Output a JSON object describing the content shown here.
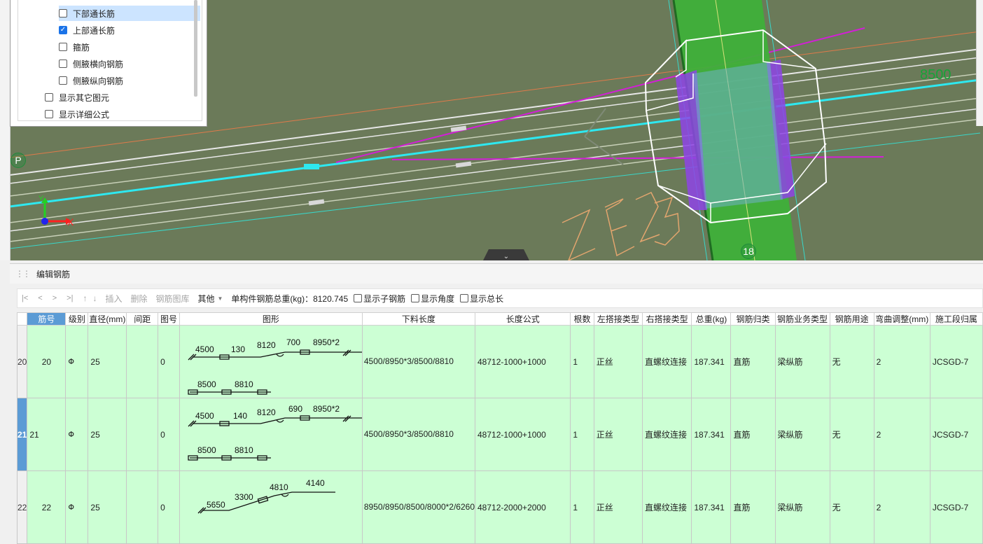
{
  "layer_panel": {
    "items": [
      {
        "label": "下部通长筋",
        "checked": false,
        "selected": true
      },
      {
        "label": "上部通长筋",
        "checked": true,
        "selected": false
      },
      {
        "label": "箍筋",
        "checked": false,
        "selected": false
      },
      {
        "label": "侧腋横向钢筋",
        "checked": false,
        "selected": false
      },
      {
        "label": "侧腋纵向钢筋",
        "checked": false,
        "selected": false
      },
      {
        "label": "显示其它图元",
        "checked": false,
        "selected": false
      },
      {
        "label": "显示详细公式",
        "checked": false,
        "selected": false
      }
    ]
  },
  "viewport": {
    "dim_label": "8500",
    "component_label": "ZE25",
    "axis_marker_p": "P",
    "axis_marker_18": "18",
    "axis_x": "X",
    "axis_y": "Y"
  },
  "editor": {
    "title": "编辑钢筋",
    "toolbar": {
      "nav": [
        "|<",
        "<",
        ">",
        ">|"
      ],
      "insert": "插入",
      "delete": "删除",
      "library": "钢筋图库",
      "other": "其他",
      "total_label": "单构件钢筋总重(kg)：8120.745",
      "checks": [
        "显示子钢筋",
        "显示角度",
        "显示总长"
      ]
    },
    "columns": [
      "筋号",
      "级别",
      "直径(mm)",
      "间距",
      "图号",
      "图形",
      "下料长度",
      "长度公式",
      "根数",
      "左搭接类型",
      "右搭接类型",
      "总重(kg)",
      "钢筋归类",
      "钢筋业务类型",
      "钢筋用途",
      "弯曲调整(mm)",
      "施工段归属"
    ],
    "rows": [
      {
        "row": "20",
        "jin": "20",
        "level": "Φ",
        "dia": "25",
        "spacing": "",
        "fig": "0",
        "shape": {
          "a": "4500",
          "b": "130",
          "c": "8120",
          "d": "700",
          "e": "8950*2",
          "f": "8500",
          "g": "8810"
        },
        "cut": "4500/8950*3/8500/8810",
        "formula": "48712-1000+1000",
        "count": "1",
        "left": "正丝",
        "right": "直螺纹连接",
        "weight": "187.341",
        "cat": "直筋",
        "biz": "梁纵筋",
        "use": "无",
        "bend": "2",
        "seg": "JCSGD-7"
      },
      {
        "row": "21",
        "jin": "21",
        "level": "Φ",
        "dia": "25",
        "spacing": "",
        "fig": "0",
        "shape": {
          "a": "4500",
          "b": "140",
          "c": "8120",
          "d": "690",
          "e": "8950*2",
          "f": "8500",
          "g": "8810"
        },
        "cut": "4500/8950*3/8500/8810",
        "formula": "48712-1000+1000",
        "count": "1",
        "left": "正丝",
        "right": "直螺纹连接",
        "weight": "187.341",
        "cat": "直筋",
        "biz": "梁纵筋",
        "use": "无",
        "bend": "2",
        "seg": "JCSGD-7"
      },
      {
        "row": "22",
        "jin": "22",
        "level": "Φ",
        "dia": "25",
        "spacing": "",
        "fig": "0",
        "shape": {
          "a": "5650",
          "b": "3300",
          "c": "4810",
          "d": "4140"
        },
        "cut": "8950/8950/8500/8000*2/6260",
        "formula": "48712-2000+2000",
        "count": "1",
        "left": "正丝",
        "right": "直螺纹连接",
        "weight": "187.341",
        "cat": "直筋",
        "biz": "梁纵筋",
        "use": "无",
        "bend": "2",
        "seg": "JCSGD-7"
      }
    ]
  }
}
